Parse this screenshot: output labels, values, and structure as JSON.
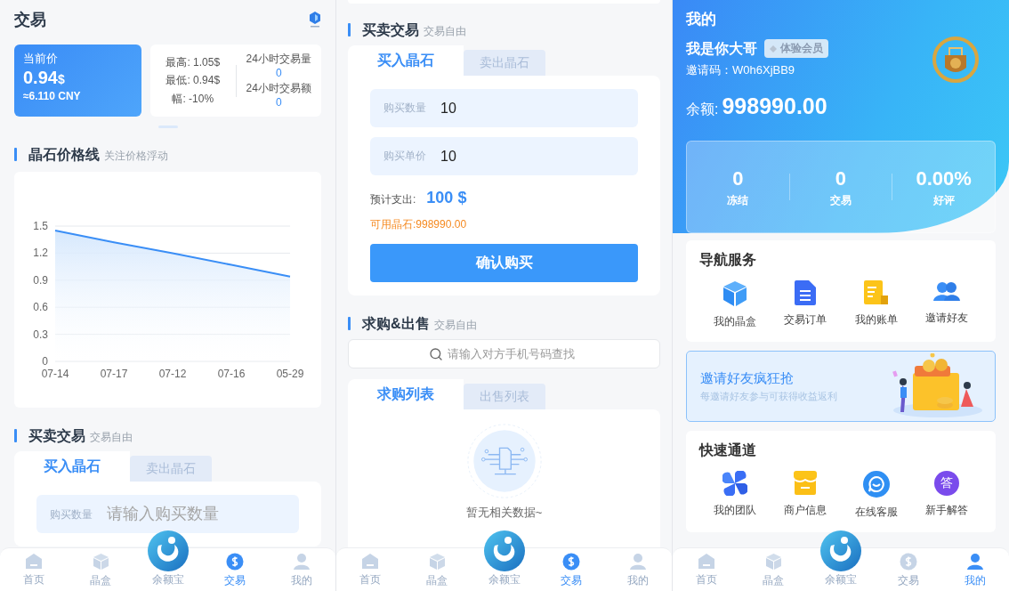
{
  "trade_page": {
    "title": "交易",
    "price_card": {
      "label": "当前价",
      "price": "0.94",
      "unit": "$",
      "cny": "≈6.110 CNY"
    },
    "stats": {
      "high": "最高: 1.05$",
      "low": "最低: 0.94$",
      "change": "幅: -10%",
      "volume_label": "24小时交易量",
      "volume": "0",
      "amount_label": "24小时交易额",
      "amount": "0"
    },
    "chart_section": {
      "title": "晶石价格线",
      "subtitle": "关注价格浮动",
      "chart_data": {
        "type": "area",
        "categories": [
          "07-14",
          "07-17",
          "07-12",
          "07-16",
          "05-29"
        ],
        "values": [
          1.45,
          1.32,
          1.2,
          1.07,
          0.94
        ],
        "ylim": [
          0,
          1.5
        ],
        "yticks": [
          0,
          0.3,
          0.6,
          0.9,
          1.2,
          1.5
        ],
        "grid": true
      }
    },
    "trade_section": {
      "title": "买卖交易",
      "subtitle": "交易自由",
      "tabs": [
        {
          "label": "买入晶石",
          "selected": true
        },
        {
          "label": "卖出晶石",
          "selected": false
        }
      ],
      "fields": [
        {
          "label": "购买数量",
          "placeholder": "请输入购买数量"
        }
      ]
    },
    "tab_bar": [
      {
        "kind": "home",
        "label": "首页",
        "selected": false
      },
      {
        "kind": "box",
        "label": "晶盒",
        "selected": false
      },
      {
        "kind": "logo",
        "label": "余额宝",
        "selected": false
      },
      {
        "kind": "dollar",
        "label": "交易",
        "selected": true
      },
      {
        "kind": "person",
        "label": "我的",
        "selected": false
      }
    ]
  },
  "trade_form_page": {
    "trade_section": {
      "title": "买卖交易",
      "subtitle": "交易自由",
      "tabs": [
        {
          "label": "买入晶石",
          "selected": true
        },
        {
          "label": "卖出晶石",
          "selected": false
        }
      ],
      "fields": [
        {
          "label": "购买数量",
          "value": "10"
        },
        {
          "label": "购买单价",
          "value": "10"
        }
      ],
      "estimate_label": "预计支出:",
      "estimate": "100 $",
      "available": "可用晶石:998990.00",
      "submit": "确认购买"
    },
    "market_section": {
      "title": "求购&出售",
      "subtitle": "交易自由",
      "search_placeholder": "请输入对方手机号码查找",
      "tabs": [
        {
          "label": "求购列表",
          "selected": true
        },
        {
          "label": "出售列表",
          "selected": false
        }
      ],
      "empty_text": "暂无相关数据~"
    },
    "tab_bar": [
      {
        "kind": "home",
        "label": "首页",
        "selected": false
      },
      {
        "kind": "box",
        "label": "晶盒",
        "selected": false
      },
      {
        "kind": "logo",
        "label": "余额宝",
        "selected": false
      },
      {
        "kind": "dollar",
        "label": "交易",
        "selected": true
      },
      {
        "kind": "person",
        "label": "我的",
        "selected": false
      }
    ]
  },
  "profile_page": {
    "title": "我的",
    "user": {
      "name": "我是你大哥",
      "badge": "体验会员",
      "invite_label": "邀请码：",
      "invite_code": "W0h6XjBB9",
      "balance_label": "余额:",
      "balance": "998990.00"
    },
    "stats": [
      {
        "value": "0",
        "label": "冻结"
      },
      {
        "value": "0",
        "label": "交易"
      },
      {
        "value": "0.00%",
        "label": "好评"
      }
    ],
    "nav_services": {
      "title": "导航服务",
      "items": [
        {
          "kind": "cube",
          "label": "我的晶盒"
        },
        {
          "kind": "document",
          "label": "交易订单"
        },
        {
          "kind": "bill",
          "label": "我的账单"
        },
        {
          "kind": "people",
          "label": "邀请好友"
        }
      ]
    },
    "banner": {
      "title": "邀请好友疯狂抢",
      "subtitle": "每邀请好友参与可获得收益返利"
    },
    "quick_access": {
      "title": "快速通道",
      "items": [
        {
          "kind": "pinwheel",
          "label": "我的团队"
        },
        {
          "kind": "shop",
          "label": "商户信息"
        },
        {
          "kind": "chat",
          "label": "在线客服"
        },
        {
          "kind": "answer",
          "label": "新手解答",
          "icon_text": "答"
        }
      ]
    },
    "tab_bar": [
      {
        "kind": "home",
        "label": "首页",
        "selected": false
      },
      {
        "kind": "box",
        "label": "晶盒",
        "selected": false
      },
      {
        "kind": "logo",
        "label": "余额宝",
        "selected": false
      },
      {
        "kind": "dollar",
        "label": "交易",
        "selected": false
      },
      {
        "kind": "person",
        "label": "我的",
        "selected": true
      }
    ]
  }
}
